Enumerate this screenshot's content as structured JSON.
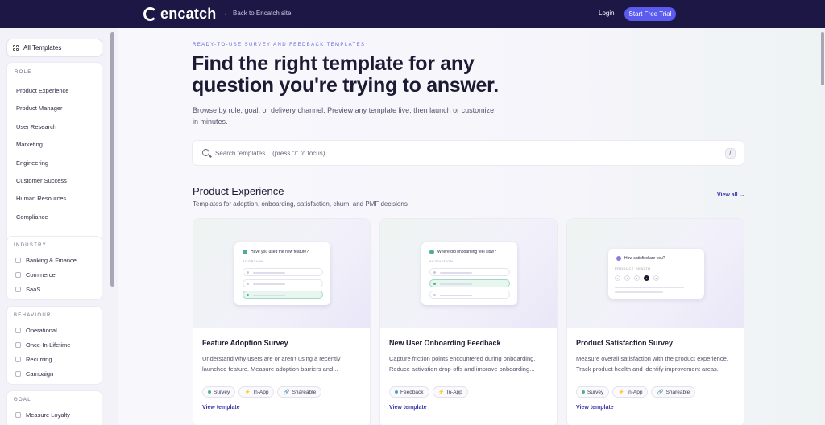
{
  "nav": {
    "logo_text": "encatch",
    "back_link": "Back to Encatch site",
    "back_arrow": "←",
    "login": "Login",
    "trial": "Start Free Trial"
  },
  "sidebar": {
    "all_templates": "All Templates",
    "role_title": "ROLE",
    "roles": [
      "Product Experience",
      "Product Manager",
      "User Research",
      "Marketing",
      "Engineering",
      "Customer Success",
      "Human Resources",
      "Compliance"
    ],
    "industry_title": "INDUSTRY",
    "industries": [
      "Banking & Finance",
      "Commerce",
      "SaaS"
    ],
    "behaviour_title": "BEHAVIOUR",
    "behaviours": [
      "Operational",
      "Once-In-Lifetime",
      "Recurring",
      "Campaign"
    ],
    "goal_title": "GOAL",
    "goals": [
      "Measure Loyalty"
    ]
  },
  "hero": {
    "eyebrow": "READY-TO-USE SURVEY AND FEEDBACK TEMPLATES",
    "headline": "Find the right template for any question you're trying to answer.",
    "intro": "Browse by role, goal, or delivery channel. Preview any template live, then launch or customize in minutes."
  },
  "search": {
    "placeholder": "Search templates... (press \"/\" to focus)",
    "kbd": "/"
  },
  "section": {
    "title": "Product Experience",
    "subtitle": "Templates for adoption, onboarding, satisfaction, churn, and PMF decisions",
    "view_all": "View all →"
  },
  "cards": [
    {
      "title": "Feature Adoption Survey",
      "desc": "Understand why users are or aren't using a recently launched feature. Measure adoption barriers and...",
      "preview_q": "Have you used the new feature?",
      "preview_tag": "ADOPTION",
      "tags": [
        "Survey",
        "In-App",
        "Shareable"
      ],
      "link": "View template"
    },
    {
      "title": "New User Onboarding Feedback",
      "desc": "Capture friction points encountered during onboarding. Reduce activation drop-offs and improve onboarding...",
      "preview_q": "Where did onboarding feel slow?",
      "preview_tag": "ACTIVATION",
      "tags": [
        "Feedback",
        "In-App"
      ],
      "link": "View template"
    },
    {
      "title": "Product Satisfaction Survey",
      "desc": "Measure overall satisfaction with the product experience. Track product health and identify improvement areas.",
      "preview_q": "How satisfied are you?",
      "preview_tag": "PRODUCT HEALTH",
      "preview_scale": [
        "1",
        "2",
        "3",
        "4",
        "5"
      ],
      "tags": [
        "Survey",
        "In-App",
        "Shareable"
      ],
      "link": "View template"
    }
  ],
  "colors": {
    "nav_bg": "#1c1745",
    "accent": "#5b5bf0",
    "survey_dot": "#4fb08d",
    "inapp_dot": "#f0b43a",
    "shareable_dot": "#7a78a0"
  }
}
